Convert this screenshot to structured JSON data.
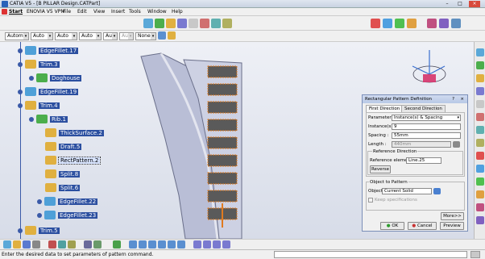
{
  "window": {
    "title": "CATIA V5 - [B PILLAR Design.CATPart]"
  },
  "menu": {
    "items": [
      "Start",
      "ENOVIA V5 VPM",
      "File",
      "Edit",
      "View",
      "Insert",
      "Tools",
      "Window",
      "Help"
    ]
  },
  "toolbar": {
    "combos": [
      "Autom",
      "Auto",
      "Auto",
      "Auto",
      "Aut",
      "Aut",
      "None"
    ]
  },
  "tree": {
    "nodes": [
      {
        "label": "EdgeFillet.17"
      },
      {
        "label": "Trim.3"
      },
      {
        "label": "Doghouse"
      },
      {
        "label": "EdgeFillet.19"
      },
      {
        "label": "Trim.4"
      },
      {
        "label": "Rib.1"
      },
      {
        "label": "ThickSurface.2"
      },
      {
        "label": "Draft.5"
      },
      {
        "label": "RectPattern.2"
      },
      {
        "label": "Split.8"
      },
      {
        "label": "Split.6"
      },
      {
        "label": "EdgeFillet.22"
      },
      {
        "label": "EdgeFillet.23"
      },
      {
        "label": "Trim.5"
      }
    ]
  },
  "dialog": {
    "title": "Rectangular Pattern Definition",
    "help": "?",
    "close": "×",
    "tabs": [
      "First Direction",
      "Second Direction"
    ],
    "parameters_label": "Parameters:",
    "parameters_value": "Instance(s) & Spacing",
    "instances_label": "Instance(s):",
    "instances_value": "9",
    "spacing_label": "Spacing :",
    "spacing_value": "55mm",
    "length_label": "Length :",
    "length_value": "440mm",
    "ref_dir_header": "Reference Direction",
    "ref_element_label": "Reference element:",
    "ref_element_value": "Line.25",
    "reverse_label": "Reverse",
    "object_header": "Object to Pattern",
    "object_label": "Object:",
    "object_value": "Current Solid",
    "keep_spec_label": "Keep specifications",
    "more_label": "More>>",
    "ok_label": "OK",
    "cancel_label": "Cancel",
    "preview_label": "Preview"
  },
  "status": {
    "message": "Enter the desired data to set parameters of pattern command."
  },
  "colors": {
    "tree_label_bg": "#2b4fa0",
    "pattern_outline": "#e07a1f",
    "ok_green": "#2e9b2e",
    "cancel_red": "#c83232"
  }
}
